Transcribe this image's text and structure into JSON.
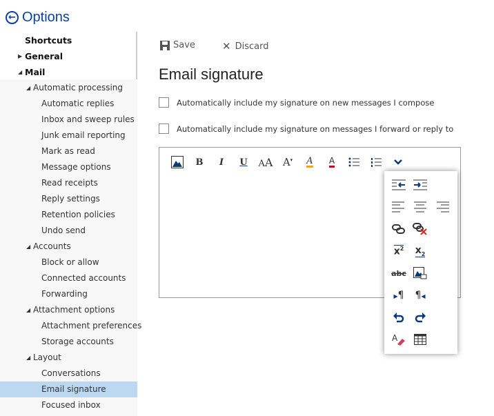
{
  "header": {
    "title": "Options",
    "back_icon": "back-arrow-icon"
  },
  "sidebar": {
    "items": [
      {
        "label": "Shortcuts",
        "level": 0,
        "arrow": ""
      },
      {
        "label": "General",
        "level": 0,
        "arrow": "▶"
      },
      {
        "label": "Mail",
        "level": 0,
        "arrow": "◢"
      },
      {
        "label": "Automatic processing",
        "level": 1,
        "arrow": "◢"
      },
      {
        "label": "Automatic replies",
        "level": 2
      },
      {
        "label": "Inbox and sweep rules",
        "level": 2
      },
      {
        "label": "Junk email reporting",
        "level": 2
      },
      {
        "label": "Mark as read",
        "level": 2
      },
      {
        "label": "Message options",
        "level": 2
      },
      {
        "label": "Read receipts",
        "level": 2
      },
      {
        "label": "Reply settings",
        "level": 2
      },
      {
        "label": "Retention policies",
        "level": 2
      },
      {
        "label": "Undo send",
        "level": 2
      },
      {
        "label": "Accounts",
        "level": 1,
        "arrow": "◢"
      },
      {
        "label": "Block or allow",
        "level": 2
      },
      {
        "label": "Connected accounts",
        "level": 2
      },
      {
        "label": "Forwarding",
        "level": 2
      },
      {
        "label": "Attachment options",
        "level": 1,
        "arrow": "◢"
      },
      {
        "label": "Attachment preferences",
        "level": 2
      },
      {
        "label": "Storage accounts",
        "level": 2
      },
      {
        "label": "Layout",
        "level": 1,
        "arrow": "◢"
      },
      {
        "label": "Conversations",
        "level": 2
      },
      {
        "label": "Email signature",
        "level": 2,
        "selected": true
      },
      {
        "label": "Focused inbox",
        "level": 2
      }
    ]
  },
  "toolbar": {
    "save_label": "Save",
    "discard_label": "Discard"
  },
  "page": {
    "title": "Email signature",
    "checkbox_new": {
      "label": "Automatically include my signature on new messages I compose",
      "checked": false
    },
    "checkbox_reply": {
      "label": "Automatically include my signature on messages I forward or reply to",
      "checked": false
    }
  },
  "colors": {
    "accent": "#0b3fa3",
    "highlight": "#f7a700",
    "font_color": "#d0021b",
    "selected": "#bcd8f0"
  }
}
